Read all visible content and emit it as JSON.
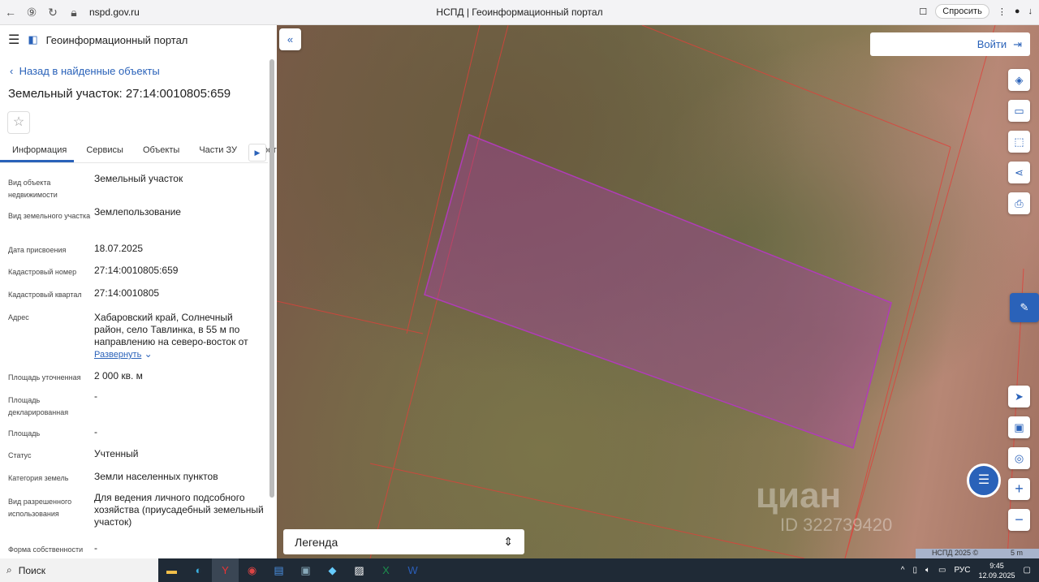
{
  "browser": {
    "url": "nspd.gov.ru",
    "page_title": "НСПД | Геоинформационный портал",
    "ask_label": "Спросить"
  },
  "panel": {
    "app_title": "Геоинформационный портал",
    "back_label": "Назад в найденные объекты",
    "title": "Земельный участок: 27:14:0010805:659",
    "tabs": [
      "Информация",
      "Сервисы",
      "Объекты",
      "Части ЗУ",
      "Соста"
    ],
    "rows": [
      {
        "k": "Вид объекта недвижимости",
        "v": "Земельный участок"
      },
      {
        "k": "Вид земельного участка",
        "v": "Землепользование"
      },
      {
        "k": "Дата присвоения",
        "v": "18.07.2025"
      },
      {
        "k": "Кадастровый номер",
        "v": "27:14:0010805:659"
      },
      {
        "k": "Кадастровый квартал",
        "v": "27:14:0010805"
      },
      {
        "k": "Адрес",
        "v": "Хабаровский край, Солнечный район, село Тавлинка, в 55 м по направлению на северо-восток от"
      },
      {
        "k": "Площадь уточненная",
        "v": "2 000 кв. м"
      },
      {
        "k": "Площадь декларированная",
        "v": "-"
      },
      {
        "k": "Площадь",
        "v": "-"
      },
      {
        "k": "Статус",
        "v": "Учтенный"
      },
      {
        "k": "Категория земель",
        "v": "Земли населенных пунктов"
      },
      {
        "k": "Вид разрешенного использования",
        "v": "Для ведения личного подсобного хозяйства (приусадебный земельный участок)"
      },
      {
        "k": "Форма собственности",
        "v": "-"
      }
    ],
    "expand_label": "Развернуть"
  },
  "map": {
    "login_label": "Войти",
    "legend_label": "Легенда",
    "copyright": "НСПД 2025 ©",
    "scale": "5 m",
    "watermark": "циан",
    "watermark_id": "ID 322739420"
  },
  "taskbar": {
    "search_label": "Поиск",
    "lang": "РУС",
    "time": "9:45",
    "date": "12.09.2025"
  }
}
